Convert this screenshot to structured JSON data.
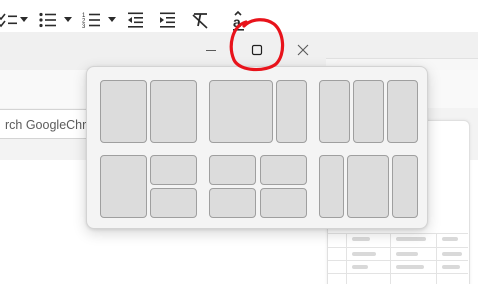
{
  "toolbar": {
    "buttons": [
      {
        "name": "checklist-icon"
      },
      {
        "name": "bulleted-list-icon"
      },
      {
        "name": "numbered-list-icon"
      },
      {
        "name": "decrease-indent-icon"
      },
      {
        "name": "increase-indent-icon"
      },
      {
        "name": "clear-formatting-icon"
      },
      {
        "name": "input-tools-icon"
      }
    ]
  },
  "window": {
    "controls": [
      "minimize",
      "maximize",
      "close"
    ]
  },
  "address_bar": {
    "text": "rch GoogleChrom"
  },
  "snap_layouts": {
    "layouts": [
      {
        "name": "two-equal-columns"
      },
      {
        "name": "wide-left-narrow-right"
      },
      {
        "name": "three-columns"
      },
      {
        "name": "left-column-right-stacked"
      },
      {
        "name": "four-quadrants"
      },
      {
        "name": "wide-center-three-columns"
      }
    ]
  },
  "colors": {
    "annotation": "#e8131b",
    "zone_fill": "#dcdcdc",
    "zone_border": "#9f9f9f",
    "flyout_bg": "#f4f4f4"
  }
}
